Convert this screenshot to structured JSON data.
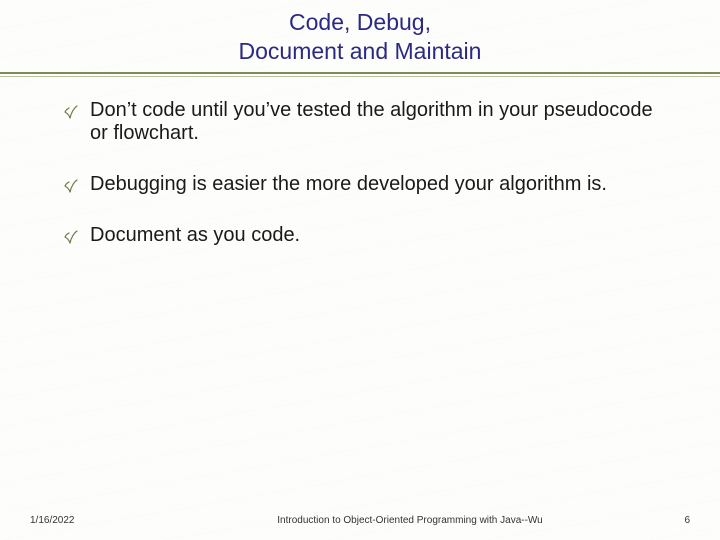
{
  "title": {
    "line1": "Code, Debug,",
    "line2": "Document and Maintain"
  },
  "bullets": [
    "Don’t code until you’ve tested the algorithm in your pseudocode or flowchart.",
    "Debugging is easier the more developed your algorithm is.",
    "Document as you code."
  ],
  "footer": {
    "date": "1/16/2022",
    "center": "Introduction to Object-Oriented Programming with Java--Wu",
    "page": "6"
  },
  "colors": {
    "title": "#2a2a85",
    "rule": "#7c8a5a",
    "bullet_tick": "#6b7a4a"
  }
}
